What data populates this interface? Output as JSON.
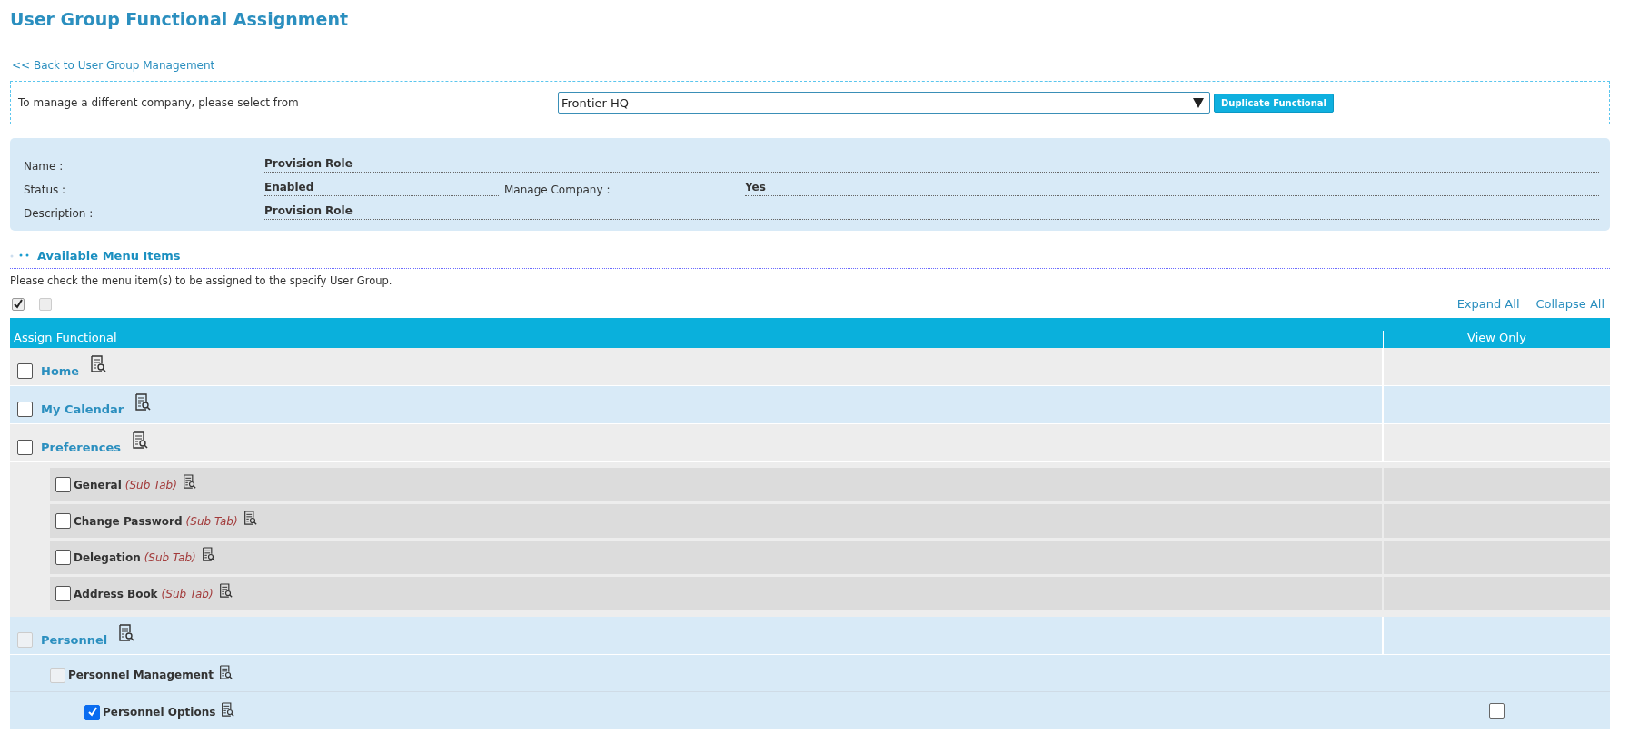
{
  "page_title": "User Group Functional Assignment",
  "back_link": "<< Back to User Group Management",
  "company_selector": {
    "label": "To manage a different company, please select from",
    "value": "Frontier HQ",
    "button": "Duplicate Functional"
  },
  "info": [
    {
      "label": "Name :",
      "value": "Provision Role"
    },
    {
      "label": "Status :",
      "value": "Enabled",
      "extra_label": "Manage Company :",
      "extra_value": "Yes"
    },
    {
      "label": "Description :",
      "value": "Provision Role"
    }
  ],
  "section_title": "Available Menu Items",
  "instructions": "Please check the menu item(s) to be assigned to the specify User Group.",
  "bulk_checkboxes": [
    {
      "checked": true,
      "disabled": false
    },
    {
      "checked": false,
      "disabled": true
    }
  ],
  "tree_links": [
    "Expand All",
    "Collapse All"
  ],
  "table": {
    "columns": [
      "Assign Functional",
      "View Only"
    ],
    "rows": [
      {
        "label": "Home",
        "checked": false,
        "disabled": false
      },
      {
        "label": "My Calendar",
        "checked": false,
        "disabled": false
      },
      {
        "label": "Preferences",
        "checked": false,
        "disabled": false,
        "children": [
          {
            "label": "General",
            "tag": "(Sub Tab)",
            "kind": "sub_tab",
            "checked": false,
            "disabled": false
          },
          {
            "label": "Change Password",
            "tag": "(Sub Tab)",
            "kind": "sub_tab",
            "checked": false,
            "disabled": false
          },
          {
            "label": "Delegation",
            "tag": "(Sub Tab)",
            "kind": "sub_tab",
            "checked": false,
            "disabled": false
          },
          {
            "label": "Address Book",
            "tag": "(Sub Tab)",
            "kind": "sub_tab",
            "checked": false,
            "disabled": false
          }
        ]
      },
      {
        "label": "Personnel",
        "checked": false,
        "disabled": true,
        "children": [
          {
            "label": "Personnel Management",
            "kind": "item",
            "checked": false,
            "disabled": true,
            "children": [
              {
                "label": "Personnel Options",
                "kind": "item",
                "checked": true,
                "disabled": false,
                "view_only": {
                  "checked": false
                }
              }
            ]
          }
        ]
      }
    ]
  }
}
